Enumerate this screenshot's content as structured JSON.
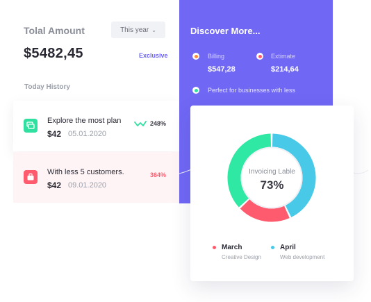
{
  "summary": {
    "total_label": "Tolal Amount",
    "period_select": "This year",
    "amount": "$5482,45",
    "exclusive_label": "Exclusive",
    "history_title": "Today History"
  },
  "history": [
    {
      "title": "Explore the most plan",
      "price": "$42",
      "date": "05.01.2020",
      "percent": "248%",
      "icon": "cards-icon"
    },
    {
      "title": "With less 5 customers.",
      "price": "$42",
      "date": "09.01.2020",
      "percent": "364%",
      "icon": "briefcase-icon"
    }
  ],
  "discover": {
    "title": "Discover More...",
    "items": [
      {
        "label": "Billing",
        "value": "$547,28",
        "color": "#ff8a3d"
      },
      {
        "label": "Extimate",
        "value": "$214,64",
        "color": "#ff5b6e"
      }
    ],
    "note": "Perfect for businesses with less",
    "note_color": "#2fe0a0"
  },
  "chart_data": {
    "type": "pie",
    "center_label": "Invoicing Lable",
    "center_value": "73%",
    "segments": [
      {
        "color": "#48c9e8",
        "value": 43
      },
      {
        "color": "#ff5b6e",
        "value": 20
      },
      {
        "color": "#2fe8a4",
        "value": 37
      }
    ],
    "legend": [
      {
        "name": "March",
        "sub": "Creative Design",
        "color": "#ff5b6e"
      },
      {
        "name": "April",
        "sub": "Web development",
        "color": "#48c9e8"
      }
    ]
  },
  "colors": {
    "accent": "#7068f5",
    "green": "#2fe0a0",
    "red": "#ff5b6e",
    "blue": "#48c9e8"
  }
}
